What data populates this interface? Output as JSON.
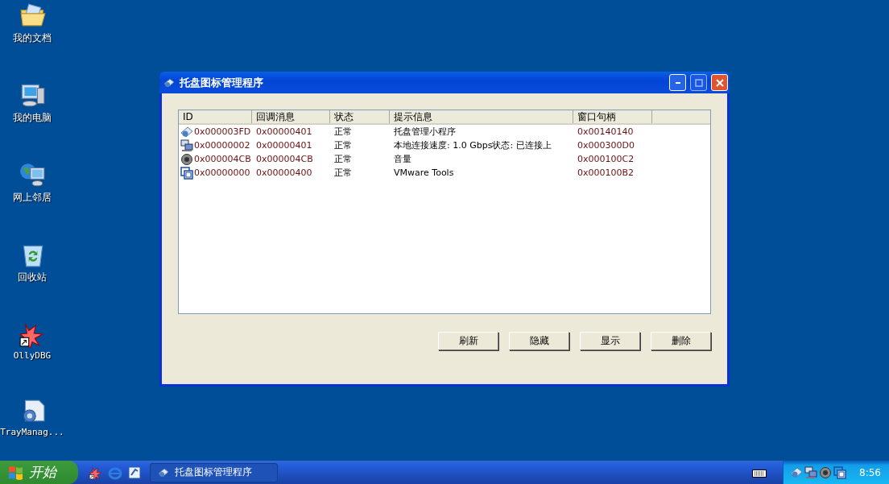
{
  "desktop_icons": [
    {
      "kind": "documents",
      "label": "我的文档"
    },
    {
      "kind": "computer",
      "label": "我的电脑"
    },
    {
      "kind": "network",
      "label": "网上邻居"
    },
    {
      "kind": "recycle",
      "label": "回收站"
    },
    {
      "kind": "debugger",
      "label": "OllyDBG"
    },
    {
      "kind": "tray",
      "label": "TrayManag..."
    }
  ],
  "window": {
    "title": "托盘图标管理程序",
    "table": {
      "columns": [
        "ID",
        "回调消息",
        "状态",
        "提示信息",
        "窗口句柄"
      ],
      "rows": [
        {
          "cells": [
            "0x000003FD",
            "0x00000401",
            "正常",
            "托盘管理小程序",
            "0x00140140"
          ]
        },
        {
          "cells": [
            "0x00000002",
            "0x00000401",
            "正常",
            "本地连接速度: 1.0 Gbps状态: 已连接上",
            "0x000300D0"
          ]
        },
        {
          "cells": [
            "0x000004CB",
            "0x000004CB",
            "正常",
            "音量",
            "0x000100C2"
          ]
        },
        {
          "cells": [
            "0x00000000",
            "0x00000400",
            "正常",
            "VMware Tools",
            "0x000100B2"
          ]
        }
      ]
    },
    "buttons": [
      "刷新",
      "隐藏",
      "显示",
      "删除"
    ]
  },
  "taskbar": {
    "start": "开始",
    "task": "托盘图标管理程序",
    "clock": "8:56"
  }
}
